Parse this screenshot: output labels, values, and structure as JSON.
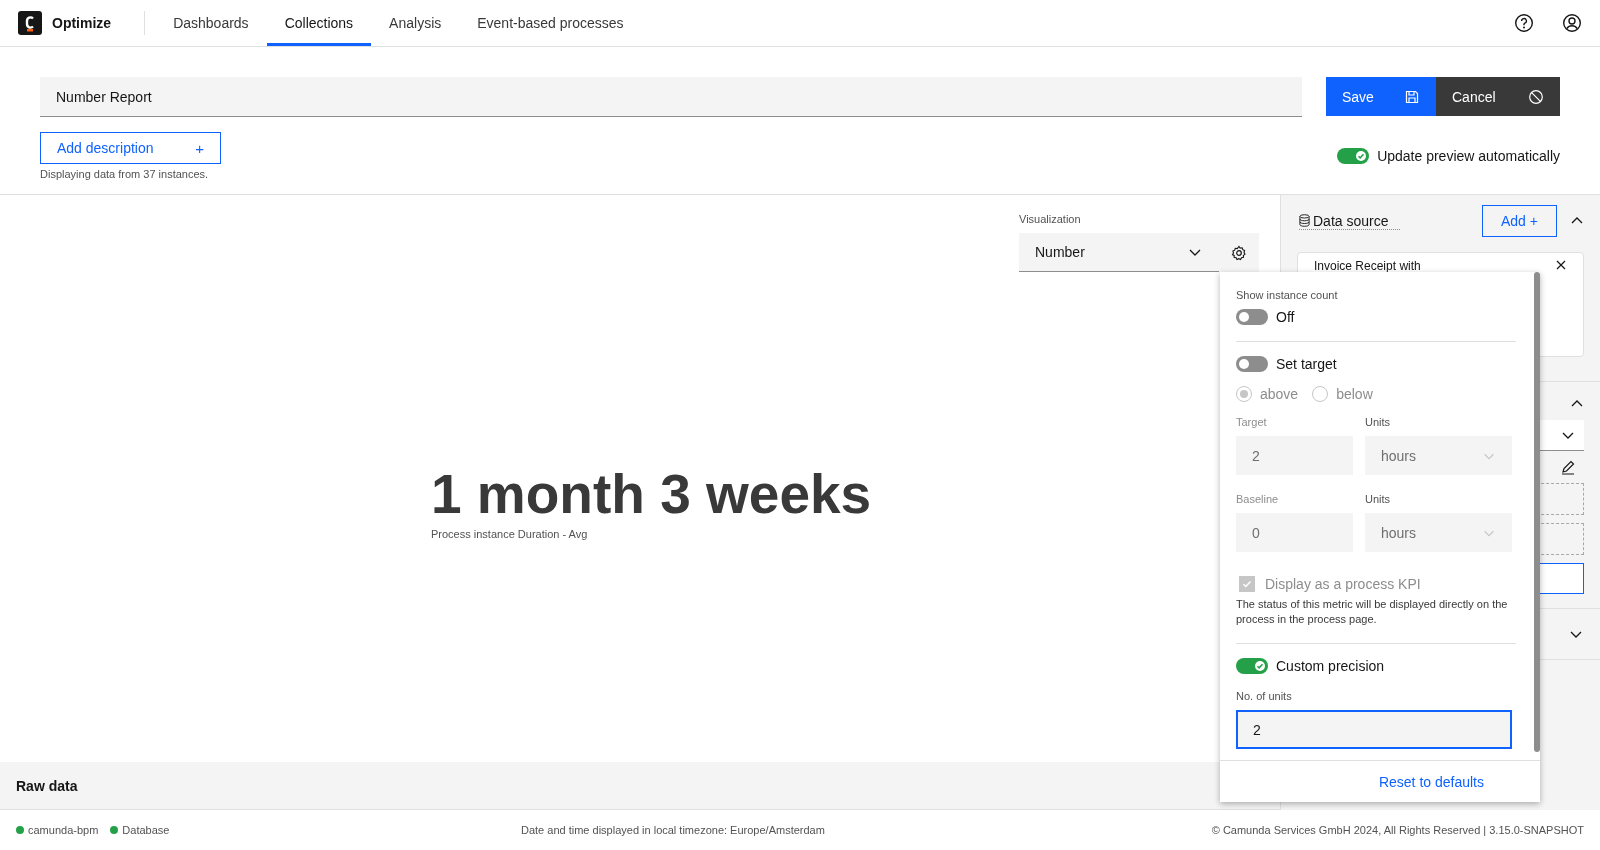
{
  "header": {
    "product": "Optimize",
    "tabs": [
      {
        "label": "Dashboards",
        "selected": false
      },
      {
        "label": "Collections",
        "selected": true
      },
      {
        "label": "Analysis",
        "selected": false
      },
      {
        "label": "Event-based processes",
        "selected": false
      }
    ]
  },
  "report": {
    "title": "Number Report",
    "add_description": "Add description",
    "add_icon": "+",
    "instances_note": "Displaying data from 37 instances.",
    "save": "Save",
    "cancel": "Cancel",
    "auto_update": {
      "label": "Update preview automatically",
      "on": true
    }
  },
  "visualization": {
    "label": "Visualization",
    "value": "Number"
  },
  "result": {
    "value": "1 month 3 weeks",
    "caption": "Process instance Duration - Avg"
  },
  "raw_data": "Raw data",
  "sidebar": {
    "data_source": {
      "title": "Data source",
      "add": "Add +",
      "card_title": "Invoice Receipt with"
    }
  },
  "settings": {
    "show_instance_count": {
      "label": "Show instance count",
      "on": false,
      "state_text": "Off"
    },
    "set_target": {
      "label": "Set target",
      "on": false
    },
    "direction": [
      {
        "label": "above",
        "selected": true
      },
      {
        "label": "below",
        "selected": false
      }
    ],
    "target": {
      "label": "Target",
      "value": "2",
      "units_label": "Units",
      "units": "hours"
    },
    "baseline": {
      "label": "Baseline",
      "value": "0",
      "units_label": "Units",
      "units": "hours"
    },
    "kpi": {
      "label": "Display as a process KPI",
      "checked": true,
      "note": "The status of this metric will be displayed directly on the process in the process page."
    },
    "custom_precision": {
      "label": "Custom precision",
      "on": true
    },
    "units_field": {
      "label": "No. of units",
      "value": "2"
    },
    "reset": "Reset to defaults"
  },
  "footer": {
    "sources": [
      {
        "name": "camunda-bpm",
        "color": "#24a148"
      },
      {
        "name": "Database",
        "color": "#24a148"
      }
    ],
    "timezone": "Date and time displayed in local timezone: Europe/Amsterdam",
    "copyright": "© Camunda Services GmbH 2024, All Rights Reserved | 3.15.0-SNAPSHOT"
  }
}
